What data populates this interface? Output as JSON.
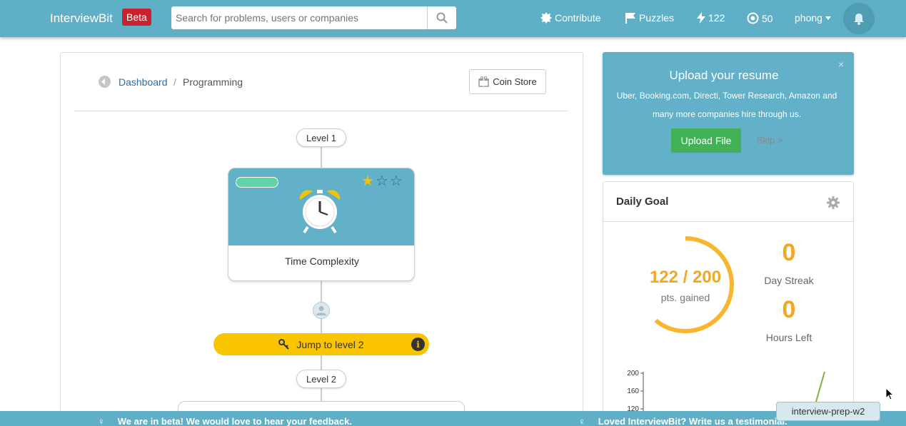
{
  "header": {
    "logo": "InterviewBit",
    "beta": "Beta",
    "search_placeholder": "Search for problems, users or companies",
    "contribute": "Contribute",
    "puzzles": "Puzzles",
    "points": "122",
    "coins": "50",
    "user": "phong"
  },
  "breadcrumb": {
    "dashboard": "Dashboard",
    "separator": "/",
    "current": "Programming"
  },
  "coin_store": "Coin Store",
  "levels": [
    {
      "label": "Level 1"
    },
    {
      "label": "Level 2"
    }
  ],
  "topic": {
    "name": "Time Complexity",
    "stars_total": 3,
    "stars_filled": 1
  },
  "jump": {
    "label": "Jump to level 2",
    "info_glyph": "i"
  },
  "resume": {
    "title": "Upload your resume",
    "body": "Uber, Booking.com, Directi, Tower Research, Amazon and many more companies hire through us.",
    "upload": "Upload File",
    "skip": "Skip >",
    "close": "×"
  },
  "daily_goal": {
    "title": "Daily Goal",
    "value": "122 / 200",
    "value_label": "pts. gained",
    "progress": 0.61,
    "day_streak": "0",
    "day_streak_label": "Day Streak",
    "hours_left": "0",
    "hours_left_label": "Hours Left",
    "chart_ticks": [
      "200",
      "160",
      "120"
    ]
  },
  "footer": {
    "left": "We are in beta! We would love to hear your feedback.",
    "right": "Loved InterviewBit? Write us a testimonial."
  },
  "tooltip": "interview-prep-w2",
  "colors": {
    "primary": "#5fb0c6",
    "beta": "#c8232c",
    "accent": "#f3a823",
    "jump": "#f8c500",
    "upload": "#43b158",
    "link": "#2a6fa8"
  }
}
